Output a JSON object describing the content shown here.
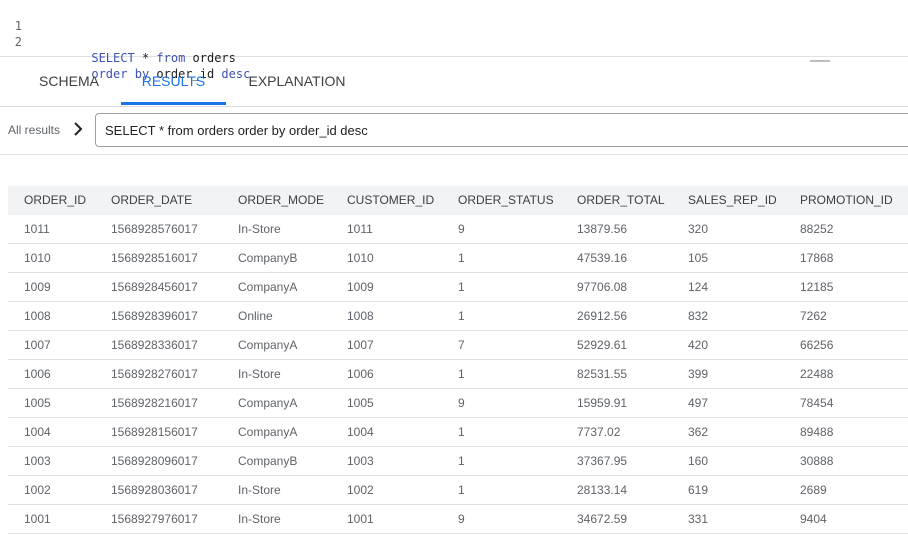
{
  "editor": {
    "lines": [
      {
        "num": "1",
        "tokens": [
          {
            "t": "SELECT",
            "k": "kw"
          },
          {
            "t": " * ",
            "k": "tx"
          },
          {
            "t": "from",
            "k": "kw"
          },
          {
            "t": " orders",
            "k": "tx"
          }
        ]
      },
      {
        "num": "2",
        "tokens": [
          {
            "t": "order",
            "k": "kw"
          },
          {
            "t": " ",
            "k": "tx"
          },
          {
            "t": "by",
            "k": "kw"
          },
          {
            "t": " order_id ",
            "k": "tx"
          },
          {
            "t": "desc",
            "k": "kw"
          }
        ]
      }
    ]
  },
  "tabs": [
    {
      "label": "SCHEMA",
      "active": false
    },
    {
      "label": "RESULTS",
      "active": true
    },
    {
      "label": "EXPLANATION",
      "active": false
    }
  ],
  "breadcrumb": {
    "label": "All results",
    "chevron": "chevron-right-icon"
  },
  "query_text": "SELECT * from orders order by order_id desc",
  "table": {
    "columns": [
      "ORDER_ID",
      "ORDER_DATE",
      "ORDER_MODE",
      "CUSTOMER_ID",
      "ORDER_STATUS",
      "ORDER_TOTAL",
      "SALES_REP_ID",
      "PROMOTION_ID"
    ],
    "rows": [
      [
        "1011",
        "1568928576017",
        "In-Store",
        "1011",
        "9",
        "13879.56",
        "320",
        "88252"
      ],
      [
        "1010",
        "1568928516017",
        "CompanyB",
        "1010",
        "1",
        "47539.16",
        "105",
        "17868"
      ],
      [
        "1009",
        "1568928456017",
        "CompanyA",
        "1009",
        "1",
        "97706.08",
        "124",
        "12185"
      ],
      [
        "1008",
        "1568928396017",
        "Online",
        "1008",
        "1",
        "26912.56",
        "832",
        "7262"
      ],
      [
        "1007",
        "1568928336017",
        "CompanyA",
        "1007",
        "7",
        "52929.61",
        "420",
        "66256"
      ],
      [
        "1006",
        "1568928276017",
        "In-Store",
        "1006",
        "1",
        "82531.55",
        "399",
        "22488"
      ],
      [
        "1005",
        "1568928216017",
        "CompanyA",
        "1005",
        "9",
        "15959.91",
        "497",
        "78454"
      ],
      [
        "1004",
        "1568928156017",
        "CompanyA",
        "1004",
        "1",
        "7737.02",
        "362",
        "89488"
      ],
      [
        "1003",
        "1568928096017",
        "CompanyB",
        "1003",
        "1",
        "37367.95",
        "160",
        "30888"
      ],
      [
        "1002",
        "1568928036017",
        "In-Store",
        "1002",
        "1",
        "28133.14",
        "619",
        "2689"
      ],
      [
        "1001",
        "1568927976017",
        "In-Store",
        "1001",
        "9",
        "34672.59",
        "331",
        "9404"
      ]
    ]
  },
  "colors": {
    "accent": "#1a73e8",
    "keyword": "#3f51b5",
    "header_bg": "#f1f3f4"
  }
}
